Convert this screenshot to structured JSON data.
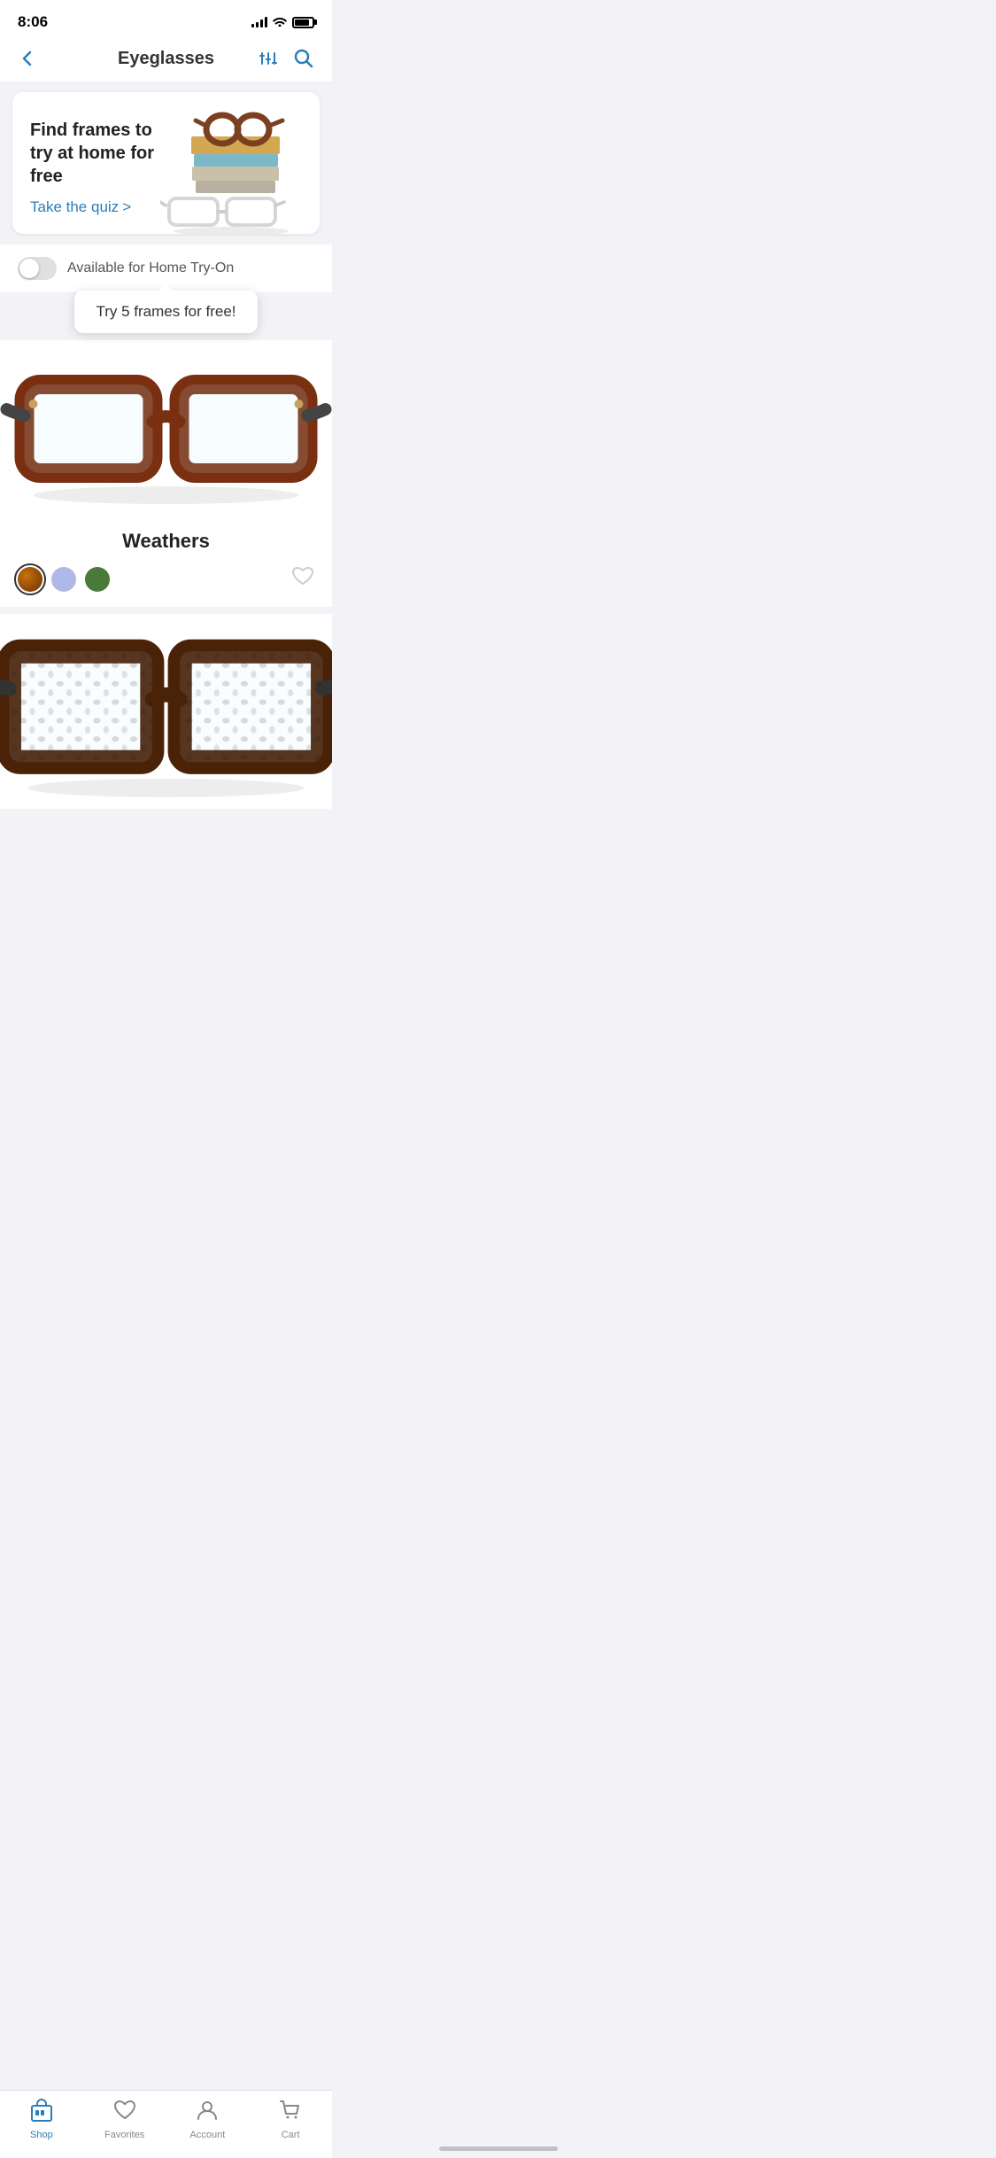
{
  "statusBar": {
    "time": "8:06"
  },
  "header": {
    "title": "Eyeglasses",
    "backLabel": "←",
    "filterLabel": "⊞",
    "searchLabel": "⌕"
  },
  "promoCard": {
    "title": "Find frames to try at home for free",
    "linkText": "Take the quiz",
    "linkChevron": ">"
  },
  "toggleRow": {
    "label": "Available for Home Try-On"
  },
  "tooltip": {
    "text": "Try 5 frames for free!"
  },
  "product1": {
    "name": "Weathers",
    "colors": [
      {
        "name": "tortoise",
        "hex": "#8B4513",
        "selected": true
      },
      {
        "name": "lavender",
        "hex": "#b0b8e8",
        "selected": false
      },
      {
        "name": "green",
        "hex": "#4a7a3a",
        "selected": false
      }
    ]
  },
  "tabBar": {
    "items": [
      {
        "label": "Shop",
        "active": true
      },
      {
        "label": "Favorites",
        "active": false
      },
      {
        "label": "Account",
        "active": false
      },
      {
        "label": "Cart",
        "active": false
      }
    ]
  }
}
